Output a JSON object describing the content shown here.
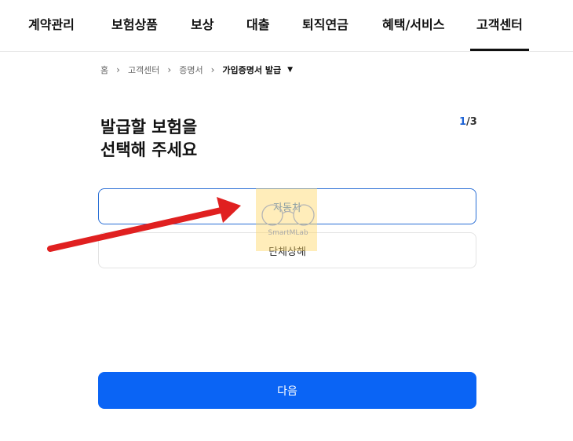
{
  "nav": {
    "items": [
      "계약관리",
      "보험상품",
      "보상",
      "대출",
      "퇴직연금",
      "혜택/서비스",
      "고객센터"
    ],
    "active": "고객센터"
  },
  "breadcrumb": {
    "items": [
      "홈",
      "고객센터",
      "증명서",
      "가입증명서 발급"
    ]
  },
  "page": {
    "title_line1": "발급할 보험을",
    "title_line2": "선택해 주세요",
    "step_current": "1",
    "step_separator": "/",
    "step_total": "3"
  },
  "options": [
    "자동차",
    "단체상해"
  ],
  "watermark": "SmartMLab",
  "next_button": "다음",
  "colors": {
    "accent": "#0a64f5",
    "selected_border": "#2a6fd6",
    "arrow": "#e02020",
    "highlight": "#ffd666"
  }
}
